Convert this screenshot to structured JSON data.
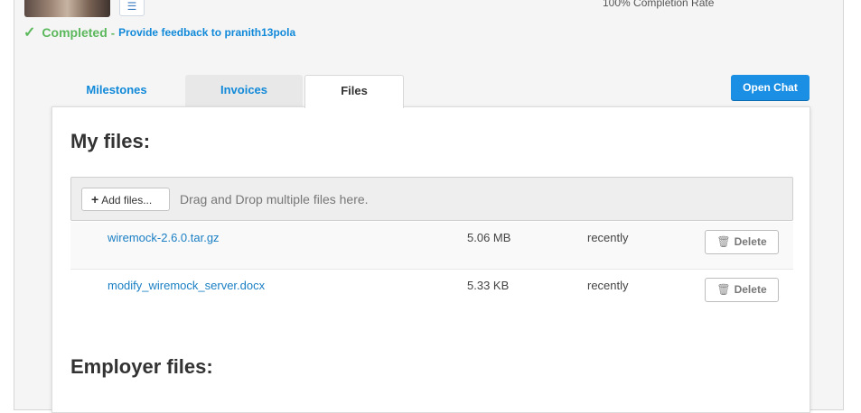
{
  "header": {
    "completion_rate": "100% Completion Rate",
    "flag_glyph": "☰"
  },
  "status": {
    "check_glyph": "✓",
    "label": "Completed",
    "separator": "-",
    "feedback_link": "Provide feedback to pranith13pola"
  },
  "tabs": [
    {
      "label": "Milestones",
      "active": false
    },
    {
      "label": "Invoices",
      "active": false
    },
    {
      "label": "Files",
      "active": true
    }
  ],
  "open_chat_label": "Open Chat",
  "my_files": {
    "heading": "My files:",
    "add_button_icon": "+",
    "add_button_label": "Add files...",
    "drop_text": "Drag and Drop multiple files here.",
    "files": [
      {
        "name": "wiremock-2.6.0.tar.gz",
        "size": "5.06 MB",
        "uploaded": "recently",
        "delete_label": "Delete"
      },
      {
        "name": "modify_wiremock_server.docx",
        "size": "5.33 KB",
        "uploaded": "recently",
        "delete_label": "Delete"
      }
    ]
  },
  "employer_files": {
    "heading": "Employer files:"
  },
  "icons": {
    "trash": "🗑",
    "check": "check-icon",
    "plus": "plus-icon"
  },
  "colors": {
    "link": "#1189d9",
    "success": "#5cb85c",
    "primary_button": "#1a8fe3"
  }
}
